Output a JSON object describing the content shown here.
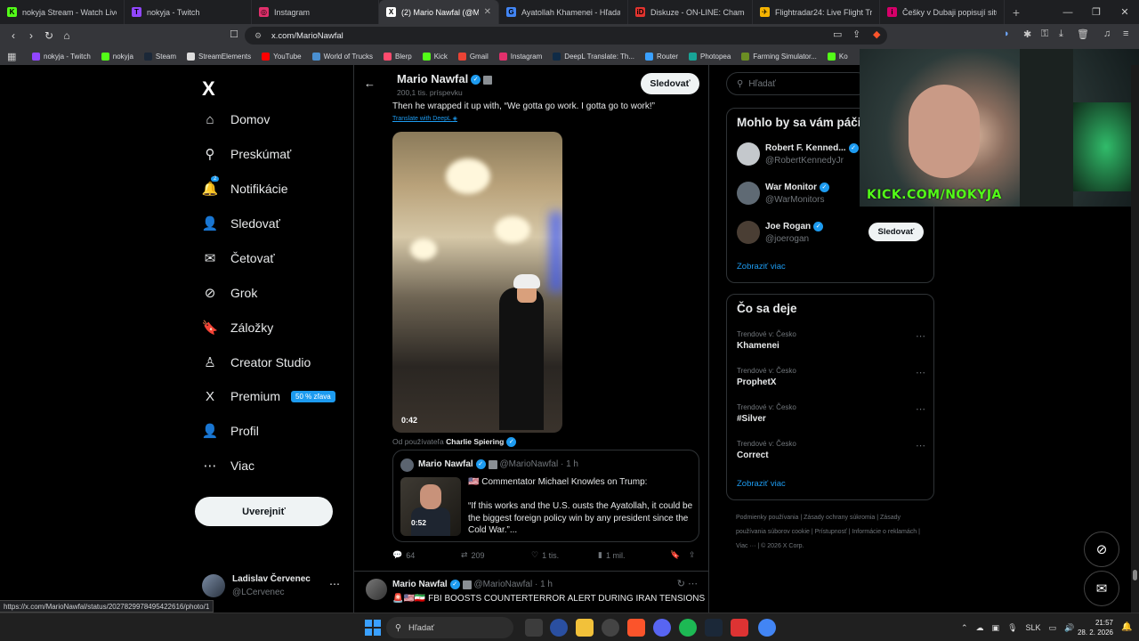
{
  "browser": {
    "tabs": [
      {
        "title": "nokyja Stream - Watch Live on",
        "color": "#53fc18",
        "glyph": "K"
      },
      {
        "title": "nokyja - Twitch",
        "color": "#9146ff",
        "glyph": "T"
      },
      {
        "title": "Instagram",
        "color": "#e1306c",
        "glyph": "◎"
      },
      {
        "title": "(2) Mario Nawfal (@Mario",
        "color": "#ffffff",
        "glyph": "X",
        "active": true
      },
      {
        "title": "Ayatollah Khamenei - Hľadať G",
        "color": "#4285f4",
        "glyph": "G"
      },
      {
        "title": "Diskuze - ON-LINE: Chamenei",
        "color": "#e3342f",
        "glyph": "iD"
      },
      {
        "title": "Flightradar24: Live Flight Track",
        "color": "#f5b301",
        "glyph": "✈"
      },
      {
        "title": "Češky v Dubaji popisují situaci",
        "color": "#d6006a",
        "glyph": "i"
      }
    ],
    "url": "x.com/MarioNawfal",
    "bookmarks": [
      {
        "label": "nokyja - Twitch",
        "color": "#9146ff"
      },
      {
        "label": "nokyja",
        "color": "#53fc18"
      },
      {
        "label": "Steam",
        "color": "#1b2838"
      },
      {
        "label": "StreamElements",
        "color": "#dddddd"
      },
      {
        "label": "YouTube",
        "color": "#ff0000"
      },
      {
        "label": "World of Trucks",
        "color": "#4a8fd1"
      },
      {
        "label": "Blerp",
        "color": "#ff4b6e"
      },
      {
        "label": "Kick",
        "color": "#53fc18"
      },
      {
        "label": "Gmail",
        "color": "#ea4335"
      },
      {
        "label": "Instagram",
        "color": "#e1306c"
      },
      {
        "label": "DeepL Translate: Th...",
        "color": "#0f2b46"
      },
      {
        "label": "Router",
        "color": "#3aa0ff"
      },
      {
        "label": "Photopea",
        "color": "#18a497"
      },
      {
        "label": "Farming Simulator...",
        "color": "#6b8e23"
      },
      {
        "label": "Ko",
        "color": "#53fc18"
      }
    ]
  },
  "nav": {
    "logo": "X",
    "items": [
      {
        "label": "Domov",
        "icon": "⌂"
      },
      {
        "label": "Preskúmať",
        "icon": "⚲"
      },
      {
        "label": "Notifikácie",
        "icon": "🔔"
      },
      {
        "label": "Sledovať",
        "icon": "👤"
      },
      {
        "label": "Četovať",
        "icon": "✉"
      },
      {
        "label": "Grok",
        "icon": "⊘"
      },
      {
        "label": "Záložky",
        "icon": "🔖"
      },
      {
        "label": "Creator Studio",
        "icon": "♙"
      },
      {
        "label": "Premium",
        "icon": "X"
      },
      {
        "label": "Profil",
        "icon": "👤"
      },
      {
        "label": "Viac",
        "icon": "⋯"
      }
    ],
    "premium_badge": "50 % zľava",
    "notif_badge": "2",
    "post_button": "Uverejniť",
    "account": {
      "name": "Ladislav Červenec",
      "handle": "@LCervenec",
      "more": "⋯"
    }
  },
  "profile": {
    "name": "Mario Nawfal",
    "posts": "200,1 tis. príspevku",
    "follow": "Sledovať"
  },
  "tweet": {
    "text": "Then he wrapped it up with, “We gotta go work. I gotta go to work!”",
    "translate": "Translate with DeepL",
    "video_duration": "0:42",
    "from_prefix": "Od používateľa",
    "from_user": "Charlie Spiering",
    "quote": {
      "name": "Mario Nawfal",
      "handle": "@MarioNawfal",
      "time": "· 1 h",
      "line1": "🇺🇸 Commentator Michael Knowles on Trump:",
      "line2": "“If this works and the U.S. ousts the Ayatollah, it could be the biggest foreign policy win by any president since the Cold War.”...",
      "duration": "0:52"
    },
    "replies": "64",
    "retweets": "209",
    "likes": "1 tis.",
    "views": "1 mil."
  },
  "tweet2": {
    "name": "Mario Nawfal",
    "handle": "@MarioNawfal",
    "time": "· 1 h",
    "text": "🚨🇺🇸🇮🇷 FBI BOOSTS COUNTERTERROR ALERT DURING IRAN TENSIONS"
  },
  "sidebar": {
    "search_placeholder": "Hľadať",
    "suggest_title": "Mohlo by sa vám páči",
    "suggestions": [
      {
        "name": "Robert F. Kenned...",
        "handle": "@RobertKennedyJr"
      },
      {
        "name": "War Monitor",
        "handle": "@WarMonitors"
      },
      {
        "name": "Joe Rogan",
        "handle": "@joerogan",
        "follow": "Sledovať"
      }
    ],
    "show_more": "Zobraziť viac",
    "trend_title": "Čo sa deje",
    "trends": [
      {
        "context": "Trendové v: Česko",
        "name": "Khamenei"
      },
      {
        "context": "Trendové v: Česko",
        "name": "ProphetX"
      },
      {
        "context": "Trendové v: Česko",
        "name": "#Silver"
      },
      {
        "context": "Trendové v: Česko",
        "name": "Correct"
      }
    ],
    "trends_more": "Zobraziť viac",
    "footer": [
      "Podmienky používania",
      "Zásady ochrany súkromia",
      "Zásady používania súborov cookie",
      "Prístupnosť",
      "Informácie o reklamách",
      "Viac ···",
      "© 2026 X Corp."
    ]
  },
  "overlay": {
    "kick": "KICK.COM/NOKYJA"
  },
  "status_url": "https://x.com/MarioNawfal/status/2027829978495422616/photo/1",
  "taskbar": {
    "search": "Hľadať",
    "lang": "SLK",
    "time": "21:57",
    "date": "28. 2. 2026"
  }
}
